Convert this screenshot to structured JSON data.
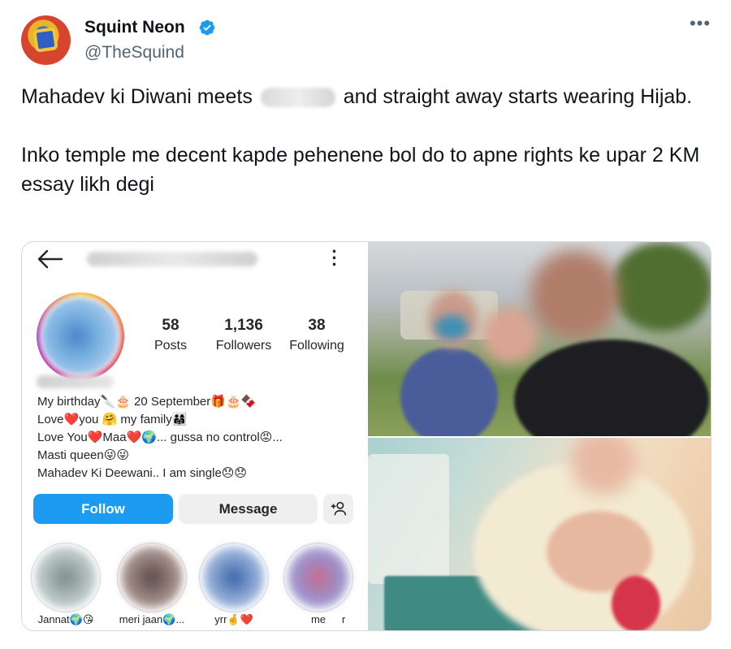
{
  "author": {
    "name": "Squint Neon",
    "handle": "@TheSquind",
    "verified": true
  },
  "menu": {
    "more_label": "•••"
  },
  "tweet": {
    "line1_before": "Mahadev ki Diwani meets",
    "line1_after": "and straight away starts wearing Hijab.",
    "para2": "Inko temple me decent kapde pehenene bol do to apne rights ke upar 2 KM essay likh degi"
  },
  "instagram": {
    "stats": [
      {
        "number": "58",
        "label": "Posts"
      },
      {
        "number": "1,136",
        "label": "Followers"
      },
      {
        "number": "38",
        "label": "Following"
      }
    ],
    "bio": [
      "My birthday🔪🎂 20 September🎁🎂🍫",
      "Love❤️you 🤗 my family👨‍👩‍👧",
      "Love You❤️Maa❤️🌍... gussa no control😡...",
      "Masti queen😜😜",
      "Mahadev Ki Deewani.. I am single😞😞"
    ],
    "buttons": {
      "follow": "Follow",
      "message": "Message",
      "add_person": "+👤"
    },
    "highlights": [
      {
        "label": "Jannat🌍😘"
      },
      {
        "label": "meri jaan🌍..."
      },
      {
        "label": "yrr🤞❤️"
      },
      {
        "label": "me"
      },
      {
        "label": "r"
      }
    ]
  },
  "colors": {
    "accent": "#1d9bf0",
    "text": "#0f1419",
    "secondary": "#536471",
    "border": "#cfd9de"
  },
  "icons": {
    "verified": "verified-badge-icon",
    "back": "arrow-left-icon",
    "kebab": "vertical-dots-icon"
  }
}
